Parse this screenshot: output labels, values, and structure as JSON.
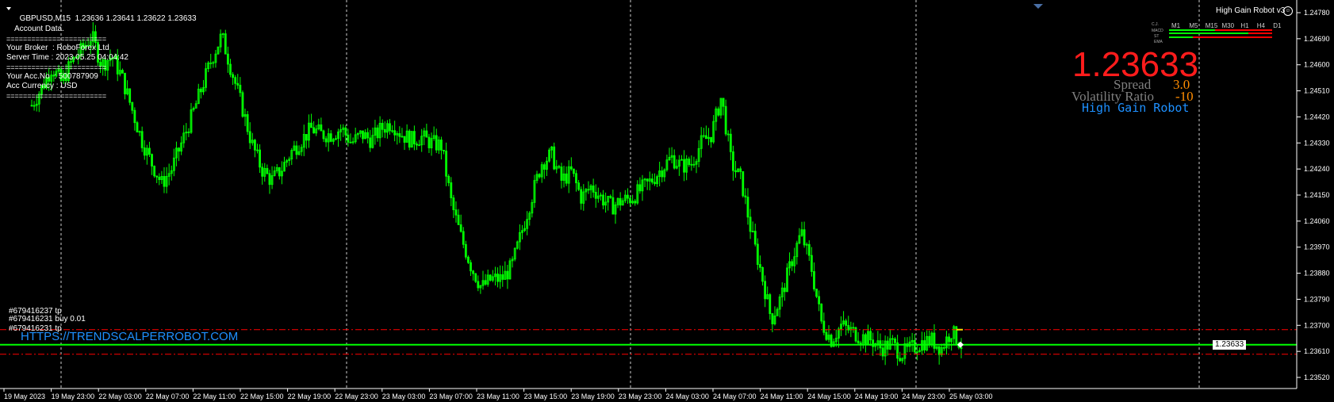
{
  "header": {
    "symbol": "GBPUSD,M15",
    "ohlc": "1.23636 1.23641 1.23622 1.23633",
    "robot_title": "High Gain Robot v3"
  },
  "account_panel": {
    "lines": [
      "Account Data.",
      "========================",
      "Your Broker  : RoboForex Ltd",
      "Server Time : 2023.05.25 04:04:42",
      "========================",
      "Your Acc.No  : 500787909",
      "Acc Currency : USD",
      "========================"
    ]
  },
  "indicator": {
    "timeframes": [
      "M1",
      "M5",
      "M15",
      "M30",
      "H1",
      "H4",
      "D1"
    ],
    "row_labels": [
      "C.J.",
      "MACD",
      "ST",
      "EMA"
    ],
    "price": "1.23633",
    "spread_label": "Spread",
    "spread_value": "3.0",
    "volatility_label": "Volatility Ratio",
    "volatility_value": "-10",
    "brand": "High Gain Robot",
    "colors": {
      "price": "#ff1c1c",
      "value": "#ff8c00",
      "brand": "#1e90ff",
      "label": "#808080"
    }
  },
  "orders": [
    {
      "label": "#679416237 tp",
      "level": 1.23685
    },
    {
      "label": "#679416231 buy 0.01",
      "level": 1.23633
    },
    {
      "label": "#679416231 tp",
      "level": 1.236
    }
  ],
  "watermark": "HTTPS://TRENDSCALPERROBOT.COM",
  "price_axis": {
    "min": 1.2352,
    "max": 1.2478,
    "ticks": [
      "1.24780",
      "1.24690",
      "1.24600",
      "1.24510",
      "1.24420",
      "1.24330",
      "1.24240",
      "1.24150",
      "1.24060",
      "1.23970",
      "1.23880",
      "1.23790",
      "1.23700",
      "1.23610",
      "1.23520"
    ],
    "current": "1.23633"
  },
  "time_axis": {
    "labels": [
      "19 May 2023",
      "19 May 23:00",
      "22 May 03:00",
      "22 May 07:00",
      "22 May 11:00",
      "22 May 15:00",
      "22 May 19:00",
      "22 May 23:00",
      "23 May 03:00",
      "23 May 07:00",
      "23 May 11:00",
      "23 May 15:00",
      "23 May 19:00",
      "23 May 23:00",
      "24 May 03:00",
      "24 May 07:00",
      "24 May 11:00",
      "24 May 15:00",
      "24 May 19:00",
      "24 May 23:00",
      "25 May 03:00"
    ]
  },
  "chart_data": {
    "type": "candlestick",
    "series_color": "#00ff00",
    "close_path": [
      1.2446,
      1.2452,
      1.2459,
      1.2454,
      1.2461,
      1.2465,
      1.247,
      1.246,
      1.2463,
      1.2456,
      1.2445,
      1.2434,
      1.2426,
      1.2419,
      1.2424,
      1.2433,
      1.2442,
      1.2452,
      1.2462,
      1.247,
      1.2458,
      1.2446,
      1.2433,
      1.2424,
      1.242,
      1.2424,
      1.243,
      1.2434,
      1.2438,
      1.2436,
      1.2436,
      1.2438,
      1.2433,
      1.2436,
      1.2434,
      1.2438,
      1.244,
      1.2436,
      1.2434,
      1.2435,
      1.2433,
      1.2432,
      1.2412,
      1.24,
      1.239,
      1.2383,
      1.2386,
      1.2386,
      1.239,
      1.2402,
      1.2414,
      1.2426,
      1.2429,
      1.242,
      1.2423,
      1.2414,
      1.2418,
      1.2414,
      1.2411,
      1.2413,
      1.2414,
      1.2417,
      1.242,
      1.2424,
      1.2428,
      1.2425,
      1.2426,
      1.2433,
      1.2436,
      1.2449,
      1.2426,
      1.242,
      1.2402,
      1.2388,
      1.2372,
      1.238,
      1.2392,
      1.2402,
      1.239,
      1.2371,
      1.2365,
      1.237,
      1.2368,
      1.2366,
      1.2365,
      1.2362,
      1.2364,
      1.236,
      1.2362,
      1.2364,
      1.2365,
      1.2362,
      1.2368,
      1.23633
    ]
  }
}
